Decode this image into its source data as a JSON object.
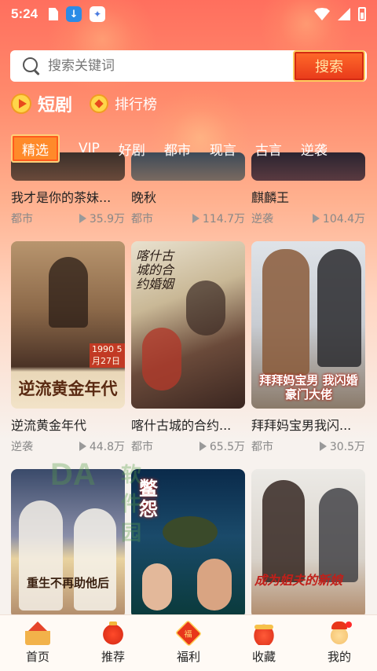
{
  "status_bar": {
    "time": "5:24"
  },
  "search": {
    "placeholder": "搜索关键词",
    "button_label": "搜索"
  },
  "categories": [
    {
      "label": "短剧",
      "icon": "play-badge-icon",
      "active": true
    },
    {
      "label": "排行榜",
      "icon": "rank-badge-icon",
      "active": false
    }
  ],
  "tabs": [
    "精选",
    "VIP",
    "好剧",
    "都市",
    "现言",
    "古言",
    "逆袭"
  ],
  "rows": [
    [
      {
        "title": "我才是你的茶妹...",
        "genre": "都市",
        "views": "35.9万"
      },
      {
        "title": "晚秋",
        "genre": "都市",
        "views": "114.7万"
      },
      {
        "title": "麒麟王",
        "genre": "逆袭",
        "views": "104.4万"
      }
    ],
    [
      {
        "title": "逆流黄金年代",
        "genre": "逆袭",
        "views": "44.8万",
        "poster_text": "逆流黄金年代",
        "poster_sub": "1990 5月27日"
      },
      {
        "title": "喀什古城的合约...",
        "genre": "都市",
        "views": "65.5万",
        "poster_text": "喀什古城的合约婚姻"
      },
      {
        "title": "拜拜妈宝男我闪...",
        "genre": "都市",
        "views": "30.5万",
        "poster_text": "拜拜妈宝男 我闪婚豪门大佬"
      }
    ],
    [
      {
        "poster_text": "重生不再助他后"
      },
      {
        "poster_text": "鳖怨"
      },
      {
        "poster_text": "成为姐夫的新娘"
      }
    ]
  ],
  "watermark": {
    "logo": "DA",
    "text": "软件园"
  },
  "bottom_nav": [
    {
      "label": "首页",
      "icon": "home-icon"
    },
    {
      "label": "推荐",
      "icon": "lantern-icon"
    },
    {
      "label": "福利",
      "icon": "fu-icon",
      "glyph": "福"
    },
    {
      "label": "收藏",
      "icon": "drum-icon"
    },
    {
      "label": "我的",
      "icon": "mascot-icon"
    }
  ],
  "colors": {
    "accent": "#ff6f5e",
    "button": "#e8391a",
    "gold": "#ffd07a"
  }
}
